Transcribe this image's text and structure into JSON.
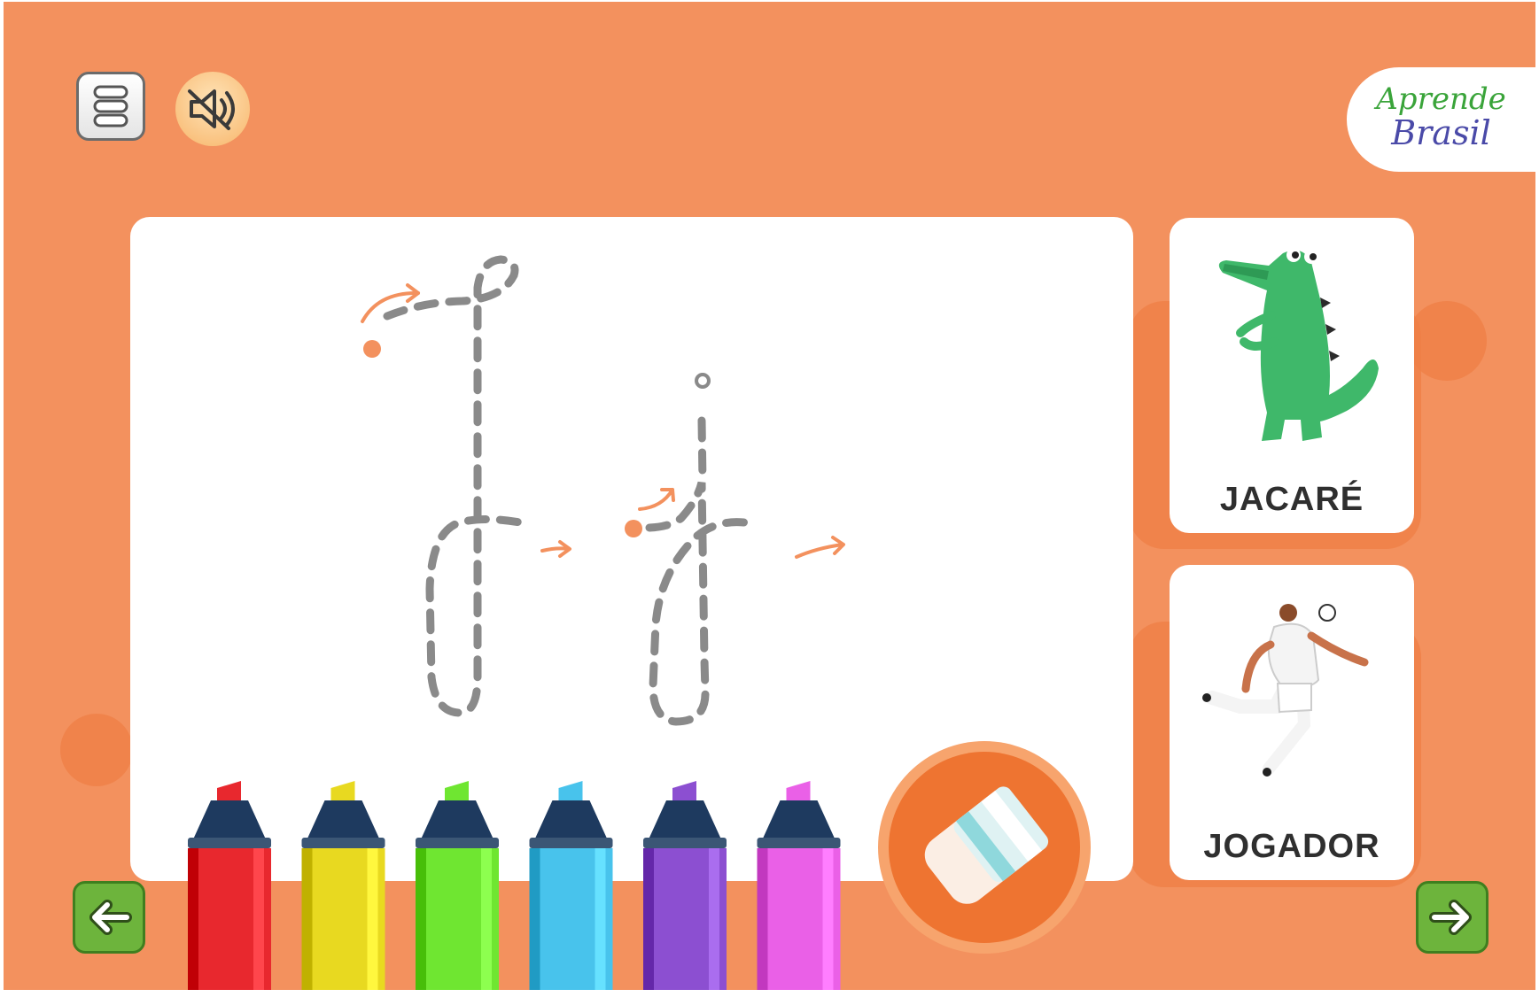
{
  "header": {
    "menu_icon": "menu-icon",
    "sound_icon": "sound-muted-icon"
  },
  "logo": {
    "line1": "Aprende",
    "line2": "Brasil"
  },
  "tracing": {
    "letters": [
      "J",
      "j"
    ],
    "guide_color": "#8a8a8a",
    "arrow_color": "#f3915e"
  },
  "cards": [
    {
      "word": "JACARÉ",
      "image": "alligator-illustration"
    },
    {
      "word": "JOGADOR",
      "image": "soccer-player-illustration"
    }
  ],
  "markers": [
    {
      "name": "red",
      "color": "#e8282e"
    },
    {
      "name": "yellow",
      "color": "#e8d920"
    },
    {
      "name": "green",
      "color": "#6fe631"
    },
    {
      "name": "blue",
      "color": "#48c3ec"
    },
    {
      "name": "purple",
      "color": "#8c4fd1"
    },
    {
      "name": "pink",
      "color": "#ea60e7"
    }
  ],
  "tools": {
    "eraser_icon": "eraser-icon"
  },
  "navigation": {
    "prev_icon": "arrow-left-icon",
    "next_icon": "arrow-right-icon"
  }
}
